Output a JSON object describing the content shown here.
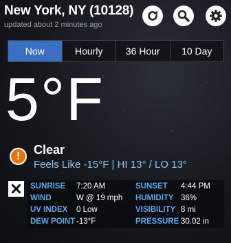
{
  "header": {
    "location": "New York, NY (10128)",
    "updated": "updated about 2 minutes ago",
    "icons": {
      "refresh": "refresh-icon",
      "search": "search-icon",
      "settings": "gear-icon"
    }
  },
  "tabs": [
    {
      "label": "Now",
      "active": true
    },
    {
      "label": "Hourly",
      "active": false
    },
    {
      "label": "36 Hour",
      "active": false
    },
    {
      "label": "10 Day",
      "active": false
    }
  ],
  "current": {
    "temperature": "5°F",
    "condition": "Clear",
    "feels_like": "Feels Like -15°F | HI 13° / LO 13°"
  },
  "details": [
    [
      {
        "label": "SUNRISE",
        "value": "7:20 AM"
      },
      {
        "label": "SUNSET",
        "value": "4:44 PM"
      }
    ],
    [
      {
        "label": "WIND",
        "value": "W @ 19 mph"
      },
      {
        "label": "HUMIDITY",
        "value": "36%"
      }
    ],
    [
      {
        "label": "UV INDEX",
        "value": "0 Low"
      },
      {
        "label": "VISIBILITY",
        "value": "8 mi"
      }
    ],
    [
      {
        "label": "DEW POINT",
        "value": "-13°F"
      },
      {
        "label": "PRESSURE",
        "value": "30.02 in"
      }
    ]
  ],
  "colors": {
    "accent": "#3a6fc4",
    "alert": "#e8730f",
    "label_blue": "#5aa6e6",
    "feels_blue": "#8fc4ee"
  }
}
